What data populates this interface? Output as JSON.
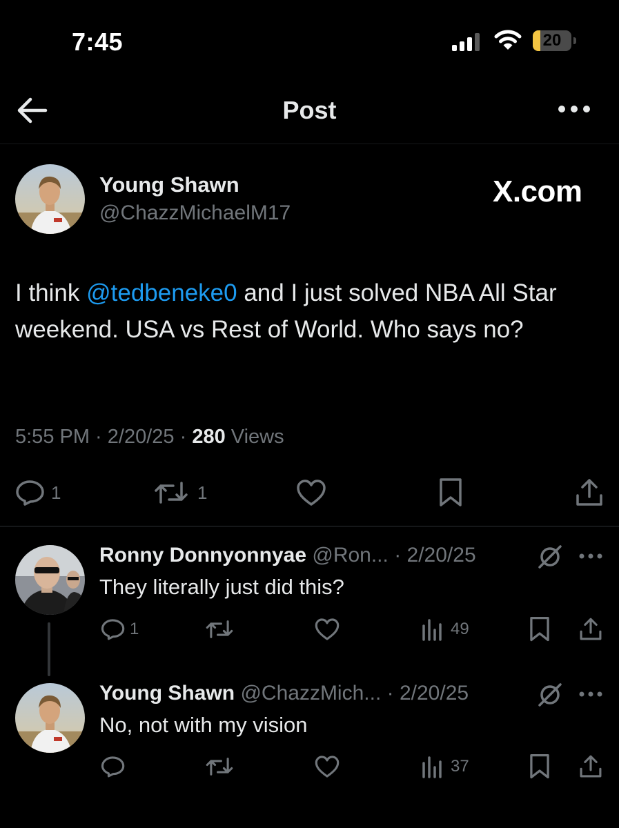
{
  "status_bar": {
    "time": "7:45",
    "battery": "20",
    "battery_level": 0.2
  },
  "nav": {
    "title": "Post"
  },
  "post": {
    "author_name": "Young Shawn",
    "author_handle": "@ChazzMichaelM17",
    "watermark": "X.com",
    "text_before": "I think ",
    "mention": "@tedbeneke0",
    "text_after": " and I just solved NBA All Star weekend. USA vs Rest of World. Who says no?",
    "time": "5:55 PM",
    "date": "2/20/25",
    "views_count": "280",
    "views_label": "Views",
    "reply_count": "1",
    "repost_count": "1"
  },
  "replies": [
    {
      "name": "Ronny Donnyonnyae",
      "handle": "@Ron...",
      "date": "2/20/25",
      "text": "They literally just did this?",
      "reply_count": "1",
      "views": "49"
    },
    {
      "name": "Young Shawn",
      "handle": "@ChazzMich...",
      "date": "2/20/25",
      "text": "No, not with my vision",
      "reply_count": "",
      "views": "37"
    }
  ],
  "colors": {
    "background": "#000000",
    "text": "#e7e9ea",
    "muted": "#71767b",
    "link": "#1d9bf0",
    "battery": "#f4c542"
  }
}
